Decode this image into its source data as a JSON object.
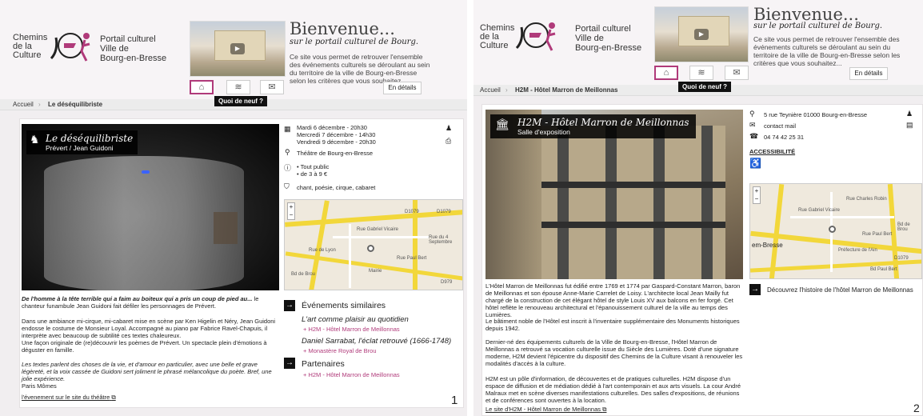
{
  "colors": {
    "accent": "#b03a7a",
    "label_bg": "#111111"
  },
  "p1": {
    "logo": "Chemins\nde la\nCulture",
    "portal": "Portail culturel\nVille de\nBourg-en-Bresse",
    "bienvenue": "Bienvenue...",
    "bienvenue_sub": "sur le portail culturel de Bourg.",
    "intro": "Ce site vous permet de retrouver l'ensemble des événements culturels se déroulant au sein du territoire de la ville de Bourg-en-Bresse selon les critères que vous souhaitez...",
    "tooltip": "Quoi de neuf ?",
    "en_details": "En détails",
    "breadcrumb": [
      "Accueil",
      "Le déséquilibriste"
    ],
    "event_title": "Le déséquilibriste",
    "event_subtitle": "Prévert / Jean Guidoni",
    "dates": [
      "Mardi 6 décembre - 20h30",
      "Mercredi 7 décembre - 14h30",
      "Vendredi 9 décembre - 20h30"
    ],
    "venue": "Théâtre de Bourg-en-Bresse",
    "info": [
      "Tout public",
      "de 3 à 9 €"
    ],
    "tags": "chant, poésie, cirque, cabaret",
    "lead": "De l'homme à la tête terrible qui a faim au boiteux qui a pris un coup de pied au...",
    "lead2": " le chanteur funambule Jean Guidoni fait défiler les personnages de Prévert.",
    "para1": "Dans une ambiance mi-cirque, mi-cabaret mise en scène par Ken Higelin et Néry, Jean Guidoni endosse le costume de Monsieur Loyal. Accompagné au piano par Fabrice Ravel-Chapuis, il interprète avec beaucoup de subtilité ces textes chaleureux.",
    "para2": "Une façon originale de (re)découvrir les poèmes de Prévert. Un spectacle plein d'émotions à déguster en famille.",
    "quote": "Les textes parlent des choses de la vie, et d'amour en particulier, avec une belle et grave légèreté, et la voix cassée de Guidoni sert joliment le phrasé mélancolique du poète. Bref, une jolie expérience.",
    "quote_src": "Paris Mômes",
    "link": "l'évenement sur le site du théâtre",
    "similar_title": "Événements similaires",
    "similar": [
      {
        "title": "L'art comme plaisir au quotidien",
        "place": "+ H2M - Hôtel Marron de Meillonnas"
      },
      {
        "title": "Daniel Sarrabat, l'éclat retrouvé (1666-1748)",
        "place": "+ Monastère Royal de Brou"
      }
    ],
    "partners_title": "Partenaires",
    "partner": "+ H2M - Hôtel Marron de Meillonnas",
    "map_labels": [
      "Rue Gabriel Vicaire",
      "Rue de Lyon",
      "D1079",
      "D1079",
      "Rue Paul Bert",
      "Mairie",
      "Rue du 4 Septembre",
      "Bd de Brou",
      "D979"
    ],
    "num": "1"
  },
  "p2": {
    "logo": "Chemins\nde la\nCulture",
    "portal": "Portail culturel\nVille de\nBourg-en-Bresse",
    "bienvenue": "Bienvenue...",
    "bienvenue_sub": "sur le portail culturel de Bourg.",
    "intro": "Ce site vous permet de retrouver l'ensemble des événements culturels se déroulant au sein du territoire de la ville de Bourg-en-Bresse selon les critères que vous souhaitez...",
    "tooltip": "Quoi de neuf ?",
    "en_details": "En détails",
    "breadcrumb": [
      "Accueil",
      "H2M - Hôtel Marron de Meillonnas"
    ],
    "place_title": "H2M - Hôtel Marron de Meillonnas",
    "place_subtitle": "Salle d'exposition",
    "address": "5 rue Teynière 01000 Bourg-en-Bresse",
    "contact": "contact mail",
    "phone": "04 74 42 25 31",
    "access": "ACCESSIBILITÉ",
    "history": "Découvrez l'histoire de l'hôtel Marron de Meillonnas",
    "para1": "L'Hôtel Marron de Meillonnas fut édifié entre 1769 et 1774 par Gaspard-Constant Marron, baron de Meillonnas et son épouse Anne-Marie Carrelet de Loisy. L'architecte local Jean Mailly fut chargé de la construction de cet élégant hôtel de style Louis XV aux balcons en fer forgé. Cet hôtel reflète le renouveau architectural et l'épanouissement culturel de la ville au temps des Lumières.",
    "para2": "Le bâtiment noble de l'Hôtel est inscrit à l'inventaire supplémentaire des Monuments historiques depuis 1942.",
    "para3": "Dernier-né des équipements culturels de la Ville de Bourg-en-Bresse, l'Hôtel Marron de Meillonnas a retrouvé sa vocation culturelle issue du Siècle des Lumières. Doté d'une signature moderne, H2M devient l'épicentre du dispositif des Chemins de la Culture visant à renouveler les modalités d'accès à la culture.",
    "para4": "H2M est un pôle d'information, de découvertes et de pratiques culturelles. H2M dispose d'un espace de diffusion et de médiation dédié à l'art contemporain et aux arts visuels. La cour André Malraux met en scène diverses manifestations culturelles. Des salles d'expositions, de réunions et de conférences sont ouvertes à la location.",
    "link": "Le site d'H2M - Hôtel Marron de Meillonnas",
    "map_labels": [
      "em-Bresse",
      "Rue Charles Robin",
      "Rue Gabriel Vicaire",
      "Préfecture de l'Ain",
      "Bd de Brou",
      "Bd Paul Bert",
      "D1079",
      "Rue Paul Bert"
    ],
    "num": "2"
  }
}
